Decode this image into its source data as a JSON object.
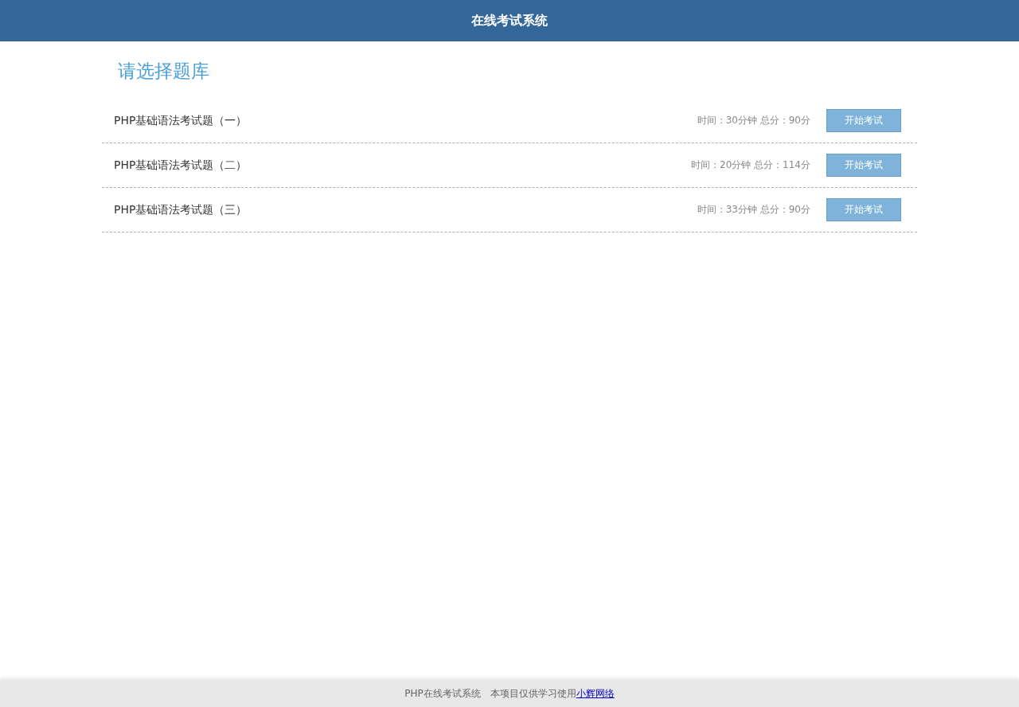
{
  "header": {
    "title": "在线考试系统"
  },
  "heading": "请选择题库",
  "exams": [
    {
      "name": "PHP基础语法考试题（一）",
      "time_label": "时间：30分钟",
      "score_label": "总分：90分",
      "button": "开始考试"
    },
    {
      "name": "PHP基础语法考试题（二）",
      "time_label": "时间：20分钟",
      "score_label": "总分：114分",
      "button": "开始考试"
    },
    {
      "name": "PHP基础语法考试题（三）",
      "time_label": "时间：33分钟",
      "score_label": "总分：90分",
      "button": "开始考试"
    }
  ],
  "footer": {
    "site": "PHP在线考试系统",
    "note": "本项目仅供学习使用",
    "link": "小辉网络"
  }
}
